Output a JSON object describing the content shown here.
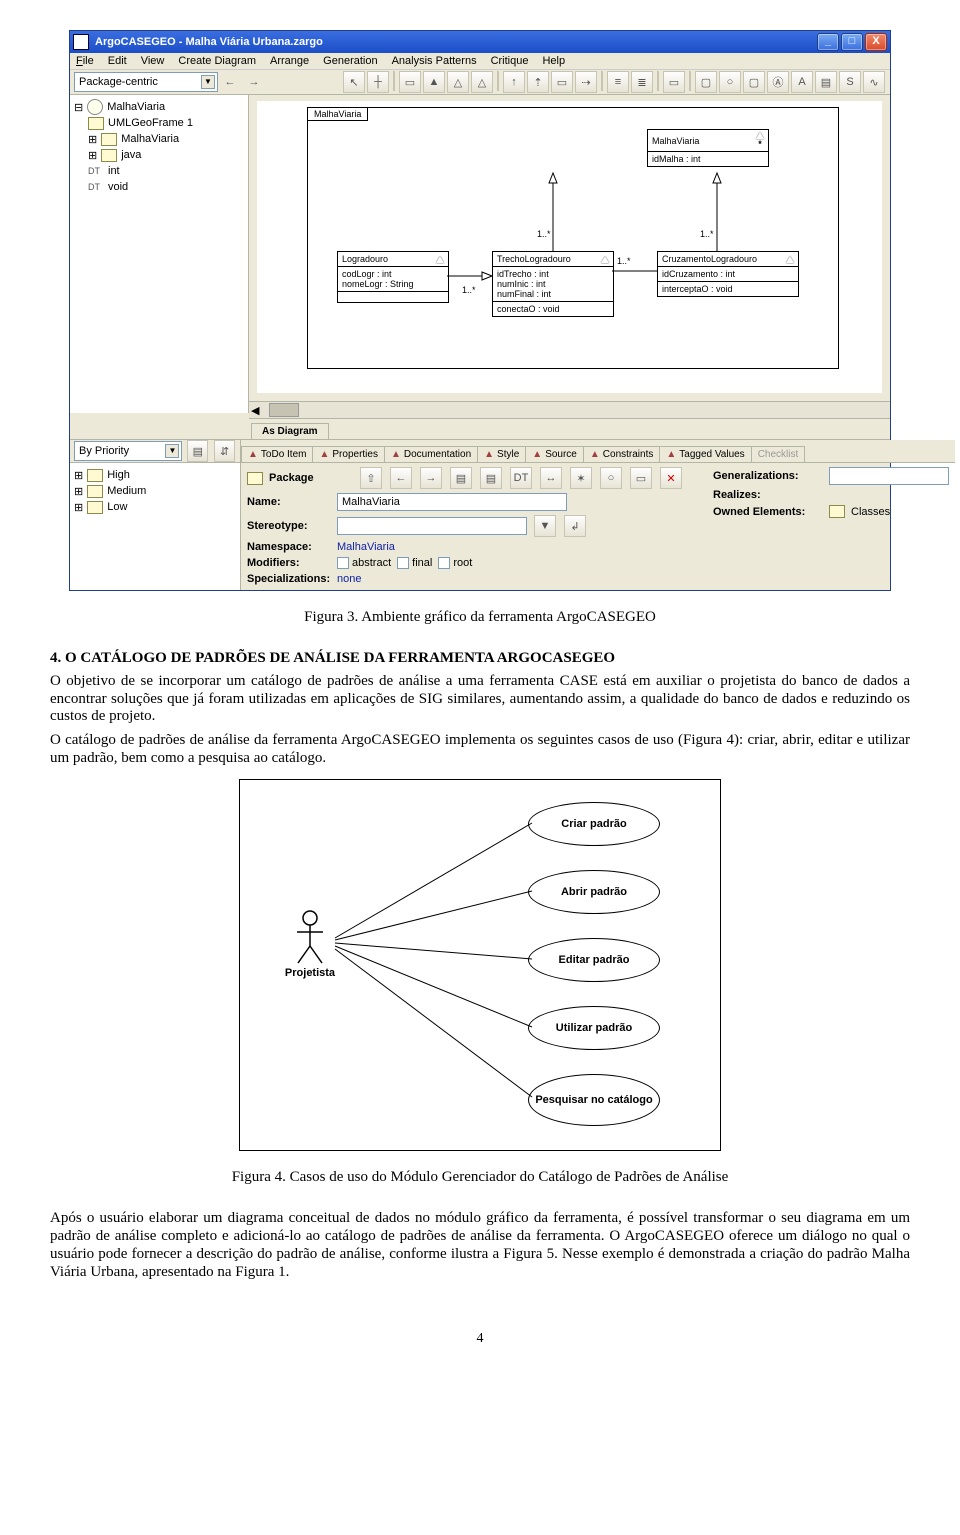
{
  "window": {
    "title": "ArgoCASEGEO - Malha Viária Urbana.zargo",
    "win_btn_min": "_",
    "win_btn_max": "□",
    "win_btn_close": "X"
  },
  "menubar": {
    "file": "File",
    "edit": "Edit",
    "view": "View",
    "create": "Create Diagram",
    "arrange": "Arrange",
    "generation": "Generation",
    "analysis": "Analysis Patterns",
    "critique": "Critique",
    "help": "Help"
  },
  "top_combo": "Package-centric",
  "tree": {
    "root": "MalhaViaria",
    "n1": "UMLGeoFrame 1",
    "n2": "MalhaViaria",
    "n3": "java",
    "n4": "int",
    "n5": "void",
    "dt": "DT"
  },
  "uml": {
    "outer_frame": "MalhaViaria",
    "class1": {
      "name": "MalhaViaria",
      "attr1": "idMalha : int"
    },
    "class2": {
      "name": "Logradouro",
      "attr1": "codLogr : int",
      "attr2": "nomeLogr : String"
    },
    "class3": {
      "name": "TrechoLogradouro",
      "attr1": "idTrecho : int",
      "attr2": "numInic : int",
      "attr3": "numFinal : int",
      "attr4": "conectaO : void"
    },
    "class4": {
      "name": "CruzamentoLogradouro",
      "attr1": "idCruzamento : int",
      "attr2": "interceptaO : void"
    },
    "mult1": "1..*",
    "mult2": "1..*",
    "mult3": "1..*",
    "mult4": "1..*"
  },
  "canvas_tab": "As Diagram",
  "priority": {
    "label": "By Priority",
    "high": "High",
    "medium": "Medium",
    "low": "Low"
  },
  "proptabs": {
    "todo": "ToDo Item",
    "properties": "Properties",
    "documentation": "Documentation",
    "style": "Style",
    "source": "Source",
    "constraints": "Constraints",
    "tagged": "Tagged Values",
    "checklist": "Checklist"
  },
  "prop": {
    "pkg": "Package",
    "name_l": "Name:",
    "name_v": "MalhaViaria",
    "stereo_l": "Stereotype:",
    "ns_l": "Namespace:",
    "ns_v": "MalhaViaria",
    "mod_l": "Modifiers:",
    "abstract": "abstract",
    "final": "final",
    "root": "root",
    "spec_l": "Specializations:",
    "spec_v": "none",
    "gen_l": "Generalizations:",
    "real_l": "Realizes:",
    "owned_l": "Owned Elements:",
    "classes": "Classes"
  },
  "captions": {
    "fig3": "Figura 3. Ambiente gráfico da ferramenta ArgoCASEGEO",
    "fig4": "Figura 4. Casos de uso do Módulo Gerenciador do Catálogo de Padrões de Análise"
  },
  "section4_title": "4. O CATÁLOGO DE PADRÕES DE ANÁLISE DA FERRAMENTA ARGOCASEGEO",
  "para1": "O objetivo de se incorporar um catálogo de padrões de análise a uma ferramenta CASE está em auxiliar o projetista do banco de dados a encontrar soluções que já foram utilizadas em aplicações de SIG similares, aumentando assim, a qualidade do banco de dados e reduzindo os custos de projeto.",
  "para2": "O catálogo de padrões de análise da ferramenta ArgoCASEGEO implementa os seguintes casos de uso (Figura 4): criar, abrir, editar e utilizar um padrão, bem como a pesquisa ao catálogo.",
  "usecases": {
    "actor": "Projetista",
    "u1": "Criar padrão",
    "u2": "Abrir padrão",
    "u3": "Editar padrão",
    "u4": "Utilizar padrão",
    "u5": "Pesquisar no catálogo"
  },
  "para3": "Após o usuário elaborar um diagrama conceitual de dados no módulo gráfico da ferramenta, é possível transformar o seu diagrama em um padrão de análise completo e adicioná-lo ao catálogo de padrões de análise da ferramenta. O ArgoCASEGEO oferece um diálogo no qual o usuário pode fornecer a descrição do padrão de análise, conforme ilustra a Figura 5. Nesse exemplo é demonstrada a criação do padrão Malha Viária Urbana, apresentado na Figura 1.",
  "pagenum": "4"
}
